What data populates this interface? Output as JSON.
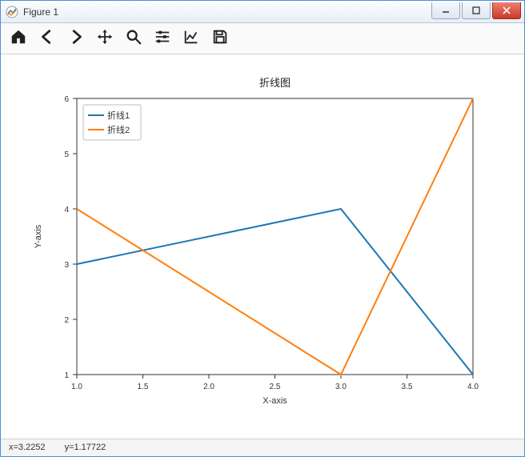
{
  "window": {
    "title": "Figure 1"
  },
  "toolbar": {
    "icons": {
      "home": "home-icon",
      "back": "back-icon",
      "forward": "forward-icon",
      "pan": "pan-icon",
      "zoom": "zoom-icon",
      "subplots": "subplots-icon",
      "axes": "axes-icon",
      "save": "save-icon"
    }
  },
  "status": {
    "x": "x=3.2252",
    "y": "y=1.17722"
  },
  "chart_data": {
    "type": "line",
    "title": "折线图",
    "xlabel": "X-axis",
    "ylabel": "Y-axis",
    "xlim": [
      1.0,
      4.0
    ],
    "ylim": [
      1,
      6
    ],
    "xticks": [
      1.0,
      1.5,
      2.0,
      2.5,
      3.0,
      3.5,
      4.0
    ],
    "yticks": [
      1,
      2,
      3,
      4,
      5,
      6
    ],
    "x": [
      1,
      2,
      3,
      4
    ],
    "series": [
      {
        "name": "折线1",
        "values": [
          3,
          3.5,
          4,
          1
        ],
        "color": "#1f77b4"
      },
      {
        "name": "折线2",
        "values": [
          4,
          2.5,
          1,
          6
        ],
        "color": "#ff7f0e"
      }
    ],
    "legend_position": "upper left"
  }
}
